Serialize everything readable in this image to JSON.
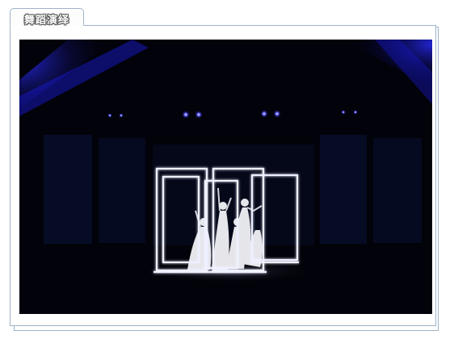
{
  "tab": {
    "label": "舞蹈演绎"
  },
  "photo": {
    "subject": "dancers-with-led-frames"
  }
}
